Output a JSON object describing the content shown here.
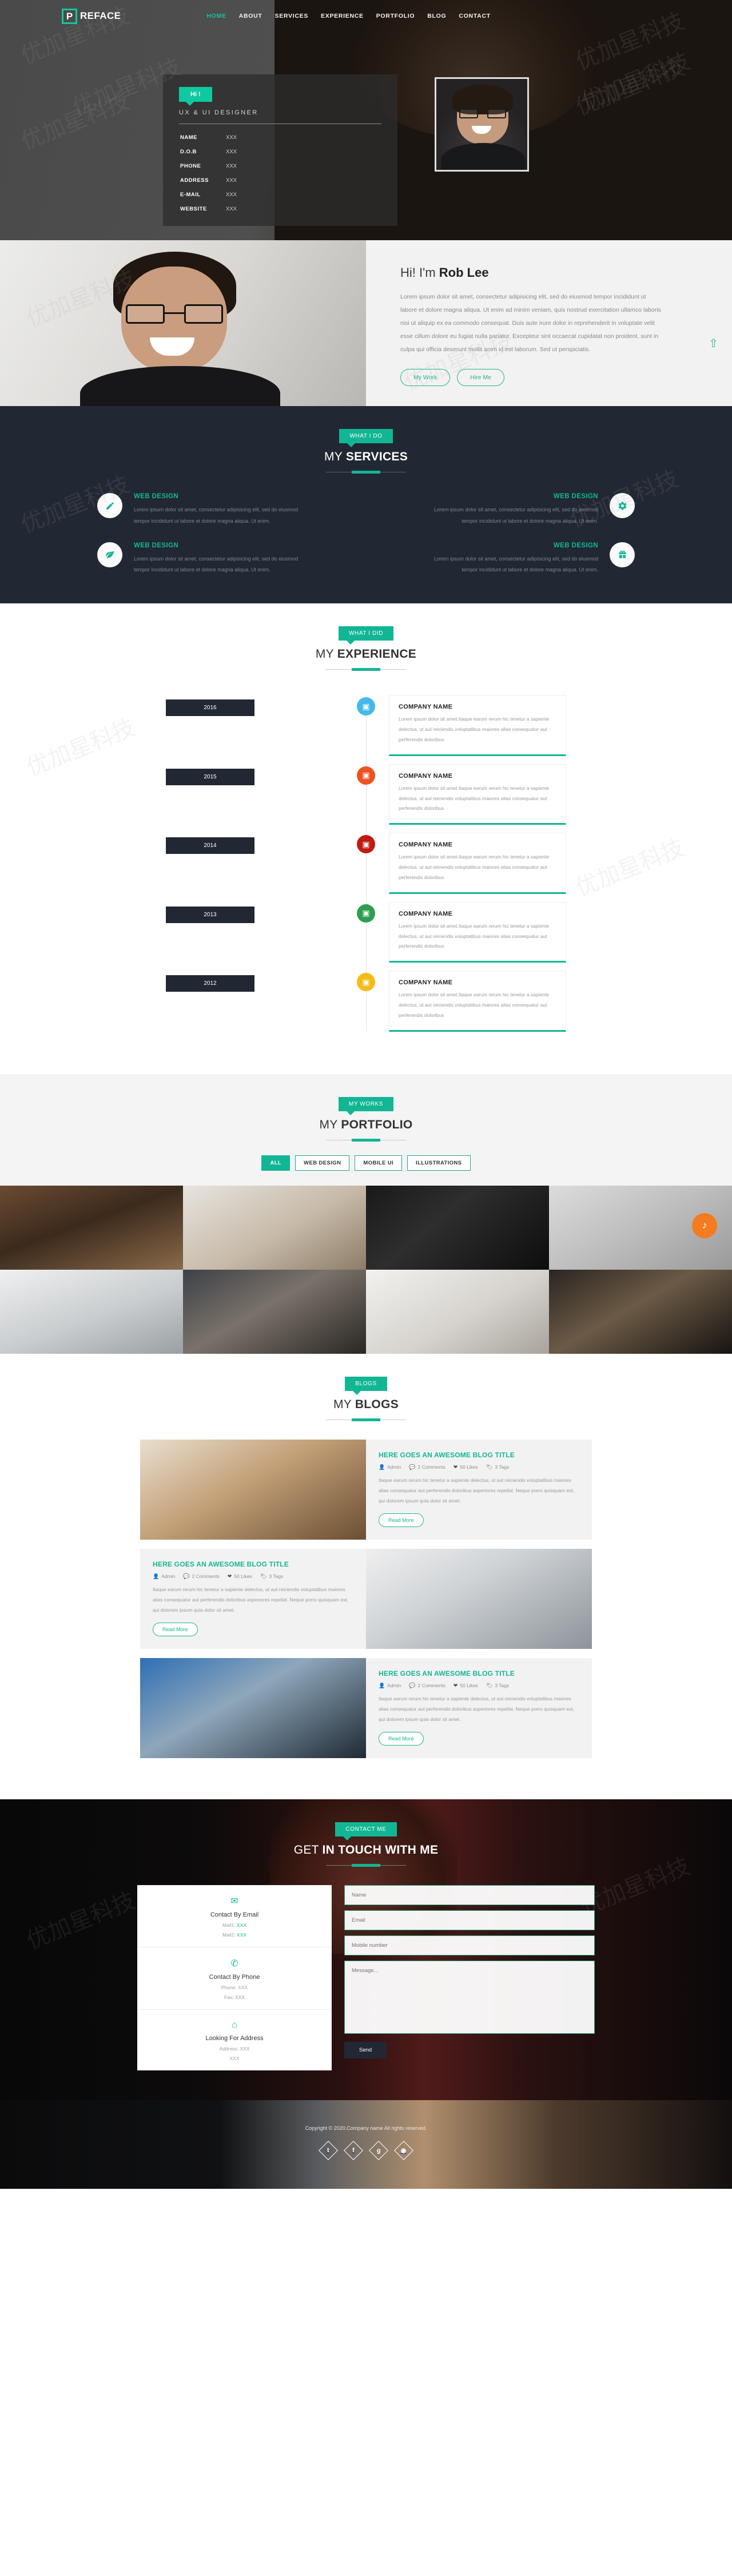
{
  "brand": {
    "logo_letter": "P",
    "logo_text": "REFACE"
  },
  "nav": {
    "items": [
      {
        "label": "HOME",
        "active": true
      },
      {
        "label": "ABOUT",
        "active": false
      },
      {
        "label": "SERVICES",
        "active": false
      },
      {
        "label": "EXPERIENCE",
        "active": false
      },
      {
        "label": "PORTFOLIO",
        "active": false
      },
      {
        "label": "BLOG",
        "active": false
      },
      {
        "label": "CONTACT",
        "active": false
      }
    ]
  },
  "hero": {
    "badge": "Hi !",
    "subtitle": "UX & UI DESIGNER",
    "info": [
      {
        "key": "NAME",
        "value": "XXX"
      },
      {
        "key": "D.O.B",
        "value": "XXX"
      },
      {
        "key": "PHONE",
        "value": "XXX"
      },
      {
        "key": "ADDRESS",
        "value": "XXX"
      },
      {
        "key": "E-MAIL",
        "value": "XXX"
      },
      {
        "key": "WEBSITE",
        "value": "XXX"
      }
    ]
  },
  "about": {
    "greeting": "Hi! I'm ",
    "name": "Rob Lee",
    "paragraph": "Lorem ipsum dolor sit amet, consectetur adipisicing elit, sed do eiusmod tempor incididunt ut labore et dolore magna aliqua. Ut enim ad minim veniam, quis nostrud exercitation ullamco laboris nisi ut aliquip ex ea commodo consequat. Duis aute irure dolor in reprehenderit in voluptate velit esse cillum dolore eu fugiat nulla pariatur. Excepteur sint occaecat cupidatat non proident, sunt in culpa qui officia deserunt mollit anim id est laborum. Sed ut perspiciatis.",
    "btn_work": "My Work",
    "btn_hire": "Hire Me",
    "scroll_top_icon": "⇧"
  },
  "services": {
    "tag": "WHAT I DO",
    "title_light": "MY ",
    "title_bold": "SERVICES",
    "items": [
      {
        "icon": "pencil-icon",
        "glyph": "✎",
        "title": "WEB DESIGN",
        "text": "Lorem ipsum dolor sit amet, consectetur adipisicing elit, sed do eiusmod tempor incididunt ut labore et dolore magna aliqua. Ut enim."
      },
      {
        "icon": "gear-icon",
        "glyph": "✿",
        "title": "WEB DESIGN",
        "text": "Lorem ipsum dolor sit amet, consectetur adipisicing elit, sed do eiusmod tempor incididunt ut labore et dolore magna aliqua. Ut enim."
      },
      {
        "icon": "leaf-icon",
        "glyph": "❧",
        "title": "WEB DESIGN",
        "text": "Lorem ipsum dolor sit amet, consectetur adipisicing elit, sed do eiusmod tempor incididunt ut labore et dolore magna aliqua. Ut enim."
      },
      {
        "icon": "gift-icon",
        "glyph": "🎁",
        "title": "WEB DESIGN",
        "text": "Lorem ipsum dolor sit amet, consectetur adipisicing elit, sed do eiusmod tempor incididunt ut labore et dolore magna aliqua. Ut enim."
      }
    ]
  },
  "experience": {
    "tag": "WHAT I DID",
    "title_light": "MY ",
    "title_bold": "EXPERIENCE",
    "items": [
      {
        "year": "2016",
        "company": "COMPANY NAME",
        "text": "Lorem ipsum dolor sit amet.Itaque earum rerum hic tenetur a sapiente delectus, ut aut reiciendis voluptatibus maiores alias consequatur aut perferendis doloribus",
        "dot_color": "#45b9e9",
        "icon": "briefcase-icon"
      },
      {
        "year": "2015",
        "company": "COMPANY NAME",
        "text": "Lorem ipsum dolor sit amet.Itaque earum rerum hic tenetur a sapiente delectus, ut aut reiciendis voluptatibus maiores alias consequatur aut perferendis doloribus",
        "dot_color": "#ef5223",
        "icon": "briefcase-icon"
      },
      {
        "year": "2014",
        "company": "COMPANY NAME",
        "text": "Lorem ipsum dolor sit amet.Itaque earum rerum hic tenetur a sapiente delectus, ut aut reiciendis voluptatibus maiores alias consequatur aut perferendis doloribus",
        "dot_color": "#c01b12",
        "icon": "briefcase-icon"
      },
      {
        "year": "2013",
        "company": "COMPANY NAME",
        "text": "Lorem ipsum dolor sit amet.Itaque earum rerum hic tenetur a sapiente delectus, ut aut reiciendis voluptatibus maiores alias consequatur aut perferendis doloribus",
        "dot_color": "#2e9e51",
        "icon": "briefcase-icon"
      },
      {
        "year": "2012",
        "company": "COMPANY NAME",
        "text": "Lorem ipsum dolor sit amet.Itaque earum rerum hic tenetur a sapiente delectus, ut aut reiciendis voluptatibus maiores alias consequatur aut perferendis doloribus",
        "dot_color": "#f6bb16",
        "icon": "briefcase-icon"
      }
    ]
  },
  "portfolio": {
    "tag": "MY WORKS",
    "title_light": "MY ",
    "title_bold": "PORTFOLIO",
    "filters": [
      {
        "label": "ALL",
        "active": true
      },
      {
        "label": "WEB DESIGN",
        "active": false
      },
      {
        "label": "MOBILE UI",
        "active": false
      },
      {
        "label": "ILLUSTRATIONS",
        "active": false
      }
    ],
    "badge_icon": "headphones-icon"
  },
  "blogs": {
    "tag": "BLOGS",
    "title_light": "MY ",
    "title_bold": "BLOGS",
    "items": [
      {
        "title": "HERE GOES AN AWESOME BLOG TITLE",
        "author": "Admin",
        "comments": "2 Comments",
        "likes": "50 Likes",
        "tags": "3 Tags",
        "text": "Itaque earum rerum hic tenetur a sapiente delectus, ut aut reiciendis voluptatibus maiores alias consequatur aut perferendis doloribus asperiores repellat. Neque porro quisquam est, qui dolorem ipsum quia dolor sit amet.",
        "read_more": "Read More",
        "image_side": "left"
      },
      {
        "title": "HERE GOES AN AWESOME BLOG TITLE",
        "author": "Admin",
        "comments": "2 Comments",
        "likes": "50 Likes",
        "tags": "3 Tags",
        "text": "Itaque earum rerum hic tenetur a sapiente delectus, ut aut reiciendis voluptatibus maiores alias consequatur aut perferendis doloribus asperiores repellat. Neque porro quisquam est, qui dolorem ipsum quia dolor sit amet.",
        "read_more": "Read More",
        "image_side": "right"
      },
      {
        "title": "HERE GOES AN AWESOME BLOG TITLE",
        "author": "Admin",
        "comments": "2 Comments",
        "likes": "50 Likes",
        "tags": "3 Tags",
        "text": "Itaque earum rerum hic tenetur a sapiente delectus, ut aut reiciendis voluptatibus maiores alias consequatur aut perferendis doloribus asperiores repellat. Neque porro quisquam est, qui dolorem ipsum quia dolor sit amet.",
        "read_more": "Read More",
        "image_side": "left"
      }
    ]
  },
  "contact": {
    "tag": "CONTACT ME",
    "title_light": "GET ",
    "title_bold": "IN TOUCH WITH ME",
    "info": [
      {
        "icon": "envelope-icon",
        "glyph": "✉",
        "title": "Contact By Email",
        "line1_label": "Mail1:",
        "line1_value": "XXX",
        "line2_label": "Mail2:",
        "line2_value": "XXX"
      },
      {
        "icon": "phone-icon",
        "glyph": "✆",
        "title": "Contact By Phone",
        "line1_label": "Phone:",
        "line1_value": "XXX",
        "line2_label": "Fax:",
        "line2_value": "XXX"
      },
      {
        "icon": "home-icon",
        "glyph": "⌂",
        "title": "Looking For Address",
        "line1_label": "Address:",
        "line1_value": "XXX",
        "line2_label": "",
        "line2_value": "XXX"
      }
    ],
    "form": {
      "name_placeholder": "Name",
      "email_placeholder": "Email",
      "mobile_placeholder": "Mobile number",
      "message_placeholder": "Message...",
      "send_label": "Send"
    }
  },
  "footer": {
    "copyright": "Copyright © 2020.Company name All rights reserved.",
    "socials": [
      {
        "name": "twitter-icon",
        "glyph": "🐦",
        "letter": "t"
      },
      {
        "name": "facebook-icon",
        "glyph": "f",
        "letter": "f"
      },
      {
        "name": "google-plus-icon",
        "glyph": "g",
        "letter": "g"
      },
      {
        "name": "dribbble-icon",
        "glyph": "◎",
        "letter": "◎"
      }
    ]
  },
  "colors": {
    "accent": "#12b694",
    "dark": "#222833",
    "accent_light": "#0fc9a0"
  }
}
